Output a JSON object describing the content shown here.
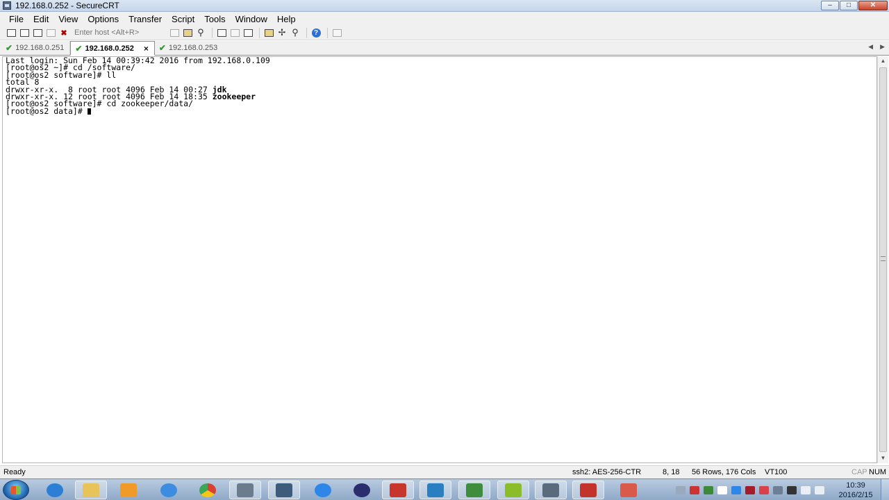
{
  "window": {
    "title": "192.168.0.252 - SecureCRT",
    "minimize_icon": "minimize-icon",
    "maximize_icon": "maximize-icon",
    "close_icon": "close-icon"
  },
  "menu": {
    "items": [
      "File",
      "Edit",
      "View",
      "Options",
      "Transfer",
      "Script",
      "Tools",
      "Window",
      "Help"
    ]
  },
  "toolbar": {
    "host_placeholder": "Enter host <Alt+R>"
  },
  "tabs": [
    {
      "label": "192.168.0.251",
      "active": false
    },
    {
      "label": "192.168.0.252",
      "active": true
    },
    {
      "label": "192.168.0.253",
      "active": false
    }
  ],
  "terminal": {
    "lines": [
      "Last login: Sun Feb 14 00:39:42 2016 from 192.168.0.109",
      "[root@os2 ~]# cd /software/",
      "[root@os2 software]# ll",
      "total 8"
    ],
    "listing": [
      {
        "perm": "drwxr-xr-x.  8 root root 4096 Feb 14 00:27 ",
        "name": "jdk"
      },
      {
        "perm": "drwxr-xr-x. 12 root root 4096 Feb 14 18:35 ",
        "name": "zookeeper"
      }
    ],
    "after": [
      "[root@os2 software]# cd zookeeper/data/",
      "[root@os2 data]# "
    ]
  },
  "status": {
    "ready": "Ready",
    "cipher": "ssh2: AES-256-CTR",
    "cursor_pos": "8,  18",
    "size": "56 Rows, 176 Cols",
    "emulation": "VT100",
    "cap": "CAP",
    "num": "NUM"
  },
  "taskbar": {
    "time": "10:39",
    "date": "2016/2/15",
    "apps": [
      {
        "name": "ie",
        "color": "#2d7fd6"
      },
      {
        "name": "explorer",
        "color": "#e8c35a"
      },
      {
        "name": "media",
        "color": "#f09a2a"
      },
      {
        "name": "baidu",
        "color": "#3c8de0"
      },
      {
        "name": "chrome",
        "color": "#d9402f"
      },
      {
        "name": "tool1",
        "color": "#6d7c8c"
      },
      {
        "name": "tool2",
        "color": "#3d5b7a"
      },
      {
        "name": "feather",
        "color": "#2e86e8"
      },
      {
        "name": "eclipse",
        "color": "#2c2d6e"
      },
      {
        "name": "filezilla",
        "color": "#c7352c"
      },
      {
        "name": "vbox",
        "color": "#2a7fc0"
      },
      {
        "name": "project",
        "color": "#3d8d3d"
      },
      {
        "name": "mindmap",
        "color": "#8bbd2a"
      },
      {
        "name": "securecrt",
        "color": "#5b6b7e"
      },
      {
        "name": "xmind",
        "color": "#c4332b"
      },
      {
        "name": "plugin",
        "color": "#d9594a"
      }
    ]
  }
}
